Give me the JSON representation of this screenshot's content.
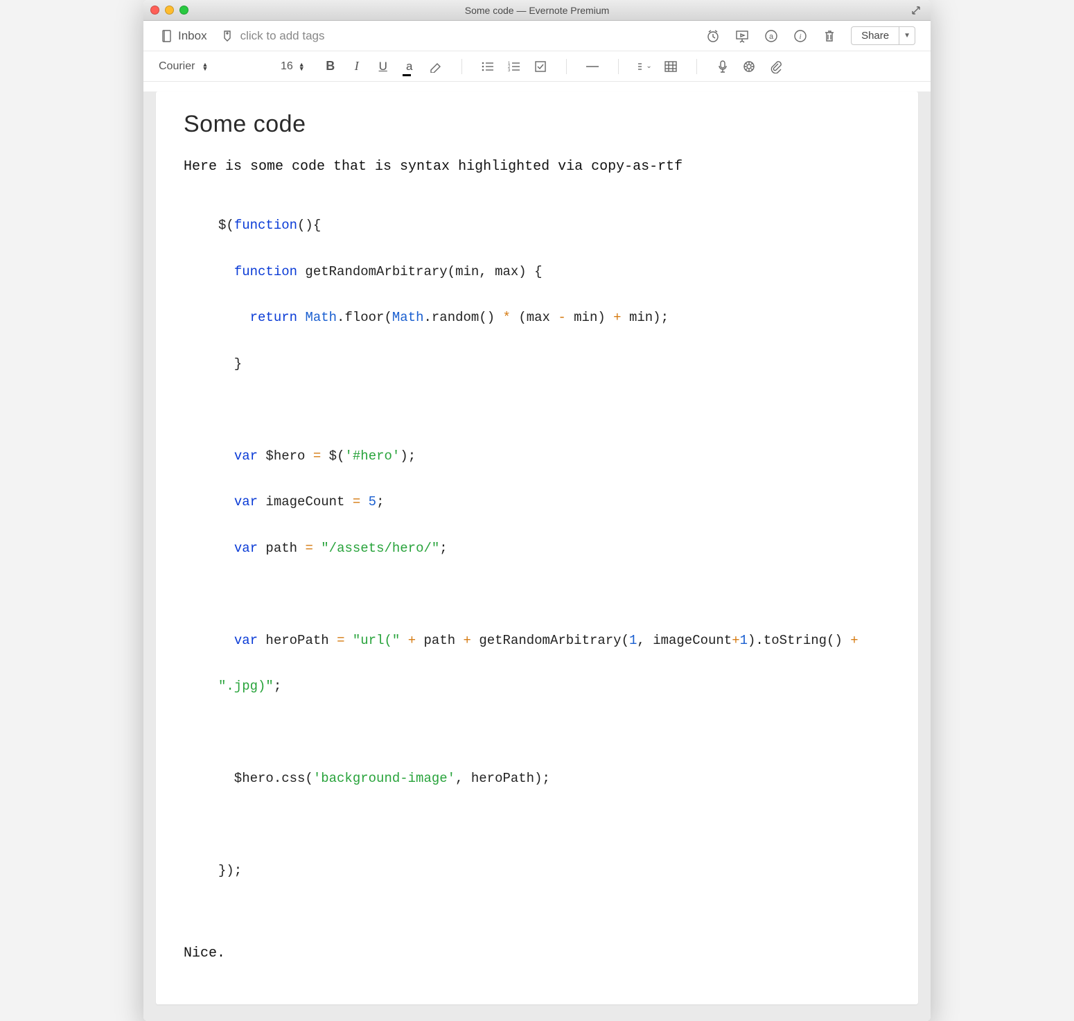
{
  "window": {
    "title": "Some code — Evernote Premium"
  },
  "tagbar": {
    "notebook": "Inbox",
    "tags_placeholder": "click to add tags",
    "share_label": "Share"
  },
  "fmt": {
    "font": "Courier",
    "size": "16"
  },
  "note": {
    "title": "Some code",
    "intro": "Here is some code that is syntax highlighted via copy-as-rtf",
    "outro": "Nice.",
    "code": {
      "l1_a": "$(",
      "l1_b": "function",
      "l1_c": "(){",
      "l2_a": "  ",
      "l2_b": "function",
      "l2_c": " getRandomArbitrary(min, max) {",
      "l3_a": "    ",
      "l3_b": "return",
      "l3_c": " ",
      "l3_d": "Math",
      "l3_e": ".floor(",
      "l3_f": "Math",
      "l3_g": ".random() ",
      "l3_h": "*",
      "l3_i": " (max ",
      "l3_j": "-",
      "l3_k": " min) ",
      "l3_l": "+",
      "l3_m": " min);",
      "l4": "  }",
      "l5": "",
      "l6_a": "  ",
      "l6_b": "var",
      "l6_c": " $hero ",
      "l6_d": "=",
      "l6_e": " $(",
      "l6_f": "'#hero'",
      "l6_g": ");",
      "l7_a": "  ",
      "l7_b": "var",
      "l7_c": " imageCount ",
      "l7_d": "=",
      "l7_e": " ",
      "l7_f": "5",
      "l7_g": ";",
      "l8_a": "  ",
      "l8_b": "var",
      "l8_c": " path ",
      "l8_d": "=",
      "l8_e": " ",
      "l8_f": "\"/assets/hero/\"",
      "l8_g": ";",
      "l9": "",
      "l10_a": "  ",
      "l10_b": "var",
      "l10_c": " heroPath ",
      "l10_d": "=",
      "l10_e": " ",
      "l10_f": "\"url(\"",
      "l10_g": " ",
      "l10_h": "+",
      "l10_i": " path ",
      "l10_j": "+",
      "l10_k": " getRandomArbitrary(",
      "l10_l": "1",
      "l10_m": ", imageCount",
      "l10_n": "+",
      "l10_o": "1",
      "l10_p": ").toString() ",
      "l10_q": "+",
      "l11_a": "",
      "l11_b": "\".jpg)\"",
      "l11_c": ";",
      "l12": "",
      "l13_a": "  $hero.css(",
      "l13_b": "'background-image'",
      "l13_c": ", heroPath);",
      "l14": "",
      "l15": "});"
    }
  }
}
